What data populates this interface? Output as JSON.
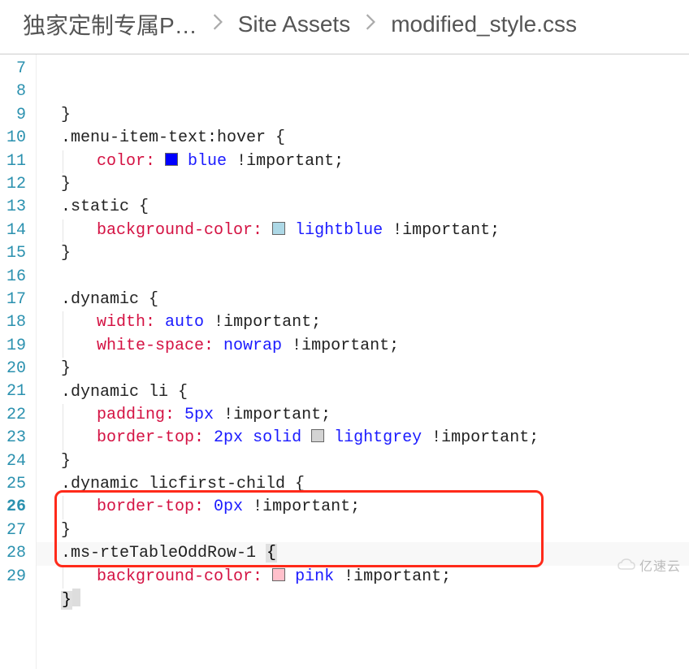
{
  "breadcrumb": {
    "items": [
      "独家定制专属P…",
      "Site Assets",
      "modified_style.css"
    ]
  },
  "colors": {
    "blue": "#0000ff",
    "lightblue": "#add8e6",
    "lightgrey": "#d3d3d3",
    "pink": "#ffc0cb"
  },
  "code": {
    "lines": [
      {
        "n": 7,
        "indent": 1,
        "tokens": [
          {
            "t": "text",
            "v": "}"
          }
        ]
      },
      {
        "n": 8,
        "indent": 1,
        "tokens": [
          {
            "t": "text",
            "v": ".menu-item-text:hover {"
          }
        ]
      },
      {
        "n": 9,
        "indent": 2,
        "guide": true,
        "tokens": [
          {
            "t": "prop",
            "v": "color:"
          },
          {
            "t": "sp",
            "v": " "
          },
          {
            "t": "swatch",
            "c": "blue"
          },
          {
            "t": "sp",
            "v": " "
          },
          {
            "t": "val",
            "v": "blue"
          },
          {
            "t": "sp",
            "v": " "
          },
          {
            "t": "imp",
            "v": "!important"
          },
          {
            "t": "text",
            "v": ";"
          }
        ]
      },
      {
        "n": 10,
        "indent": 1,
        "tokens": [
          {
            "t": "text",
            "v": "}"
          }
        ]
      },
      {
        "n": 11,
        "indent": 1,
        "tokens": [
          {
            "t": "text",
            "v": ".static {"
          }
        ]
      },
      {
        "n": 12,
        "indent": 2,
        "guide": true,
        "tokens": [
          {
            "t": "prop",
            "v": "background-color:"
          },
          {
            "t": "sp",
            "v": " "
          },
          {
            "t": "swatch",
            "c": "lightblue"
          },
          {
            "t": "sp",
            "v": " "
          },
          {
            "t": "val",
            "v": "lightblue"
          },
          {
            "t": "sp",
            "v": " "
          },
          {
            "t": "imp",
            "v": "!important"
          },
          {
            "t": "text",
            "v": ";"
          }
        ]
      },
      {
        "n": 13,
        "indent": 1,
        "tokens": [
          {
            "t": "text",
            "v": "}"
          }
        ]
      },
      {
        "n": 14,
        "indent": 1,
        "tokens": []
      },
      {
        "n": 15,
        "indent": 1,
        "tokens": [
          {
            "t": "text",
            "v": ".dynamic {"
          }
        ]
      },
      {
        "n": 16,
        "indent": 2,
        "guide": true,
        "tokens": [
          {
            "t": "prop",
            "v": "width:"
          },
          {
            "t": "sp",
            "v": " "
          },
          {
            "t": "val",
            "v": "auto"
          },
          {
            "t": "sp",
            "v": " "
          },
          {
            "t": "imp",
            "v": "!important"
          },
          {
            "t": "text",
            "v": ";"
          }
        ]
      },
      {
        "n": 17,
        "indent": 2,
        "guide": true,
        "tokens": [
          {
            "t": "prop",
            "v": "white-space:"
          },
          {
            "t": "sp",
            "v": " "
          },
          {
            "t": "val",
            "v": "nowrap"
          },
          {
            "t": "sp",
            "v": " "
          },
          {
            "t": "imp",
            "v": "!important"
          },
          {
            "t": "text",
            "v": ";"
          }
        ]
      },
      {
        "n": 18,
        "indent": 1,
        "tokens": [
          {
            "t": "text",
            "v": "}"
          }
        ]
      },
      {
        "n": 19,
        "indent": 1,
        "tokens": [
          {
            "t": "text",
            "v": ".dynamic li {"
          }
        ]
      },
      {
        "n": 20,
        "indent": 2,
        "guide": true,
        "tokens": [
          {
            "t": "prop",
            "v": "padding:"
          },
          {
            "t": "sp",
            "v": " "
          },
          {
            "t": "val",
            "v": "5px"
          },
          {
            "t": "sp",
            "v": " "
          },
          {
            "t": "imp",
            "v": "!important"
          },
          {
            "t": "text",
            "v": ";"
          }
        ]
      },
      {
        "n": 21,
        "indent": 2,
        "guide": true,
        "tokens": [
          {
            "t": "prop",
            "v": "border-top:"
          },
          {
            "t": "sp",
            "v": " "
          },
          {
            "t": "val",
            "v": "2px"
          },
          {
            "t": "sp",
            "v": " "
          },
          {
            "t": "val",
            "v": "solid"
          },
          {
            "t": "sp",
            "v": " "
          },
          {
            "t": "swatch",
            "c": "lightgrey"
          },
          {
            "t": "sp",
            "v": " "
          },
          {
            "t": "val",
            "v": "lightgrey"
          },
          {
            "t": "sp",
            "v": " "
          },
          {
            "t": "imp",
            "v": "!important"
          },
          {
            "t": "text",
            "v": ";"
          }
        ]
      },
      {
        "n": 22,
        "indent": 1,
        "tokens": [
          {
            "t": "text",
            "v": "}"
          }
        ]
      },
      {
        "n": 23,
        "indent": 1,
        "tokens": [
          {
            "t": "text",
            "v": ".dynamic licfirst-child {"
          }
        ]
      },
      {
        "n": 24,
        "indent": 2,
        "guide": true,
        "tokens": [
          {
            "t": "prop",
            "v": "border-top:"
          },
          {
            "t": "sp",
            "v": " "
          },
          {
            "t": "val",
            "v": "0px"
          },
          {
            "t": "sp",
            "v": " "
          },
          {
            "t": "imp",
            "v": "!important"
          },
          {
            "t": "text",
            "v": ";"
          }
        ]
      },
      {
        "n": 25,
        "indent": 1,
        "tokens": [
          {
            "t": "text",
            "v": "}"
          }
        ]
      },
      {
        "n": 26,
        "indent": 1,
        "current": true,
        "tokens": [
          {
            "t": "text",
            "v": ".ms-rteTableOddRow-1 "
          },
          {
            "t": "bm",
            "v": "{"
          }
        ]
      },
      {
        "n": 27,
        "indent": 2,
        "guide": true,
        "tokens": [
          {
            "t": "prop",
            "v": "background-color:"
          },
          {
            "t": "sp",
            "v": " "
          },
          {
            "t": "swatch",
            "c": "pink"
          },
          {
            "t": "sp",
            "v": " "
          },
          {
            "t": "val",
            "v": "pink"
          },
          {
            "t": "sp",
            "v": " "
          },
          {
            "t": "imp",
            "v": "!important"
          },
          {
            "t": "text",
            "v": ";"
          }
        ]
      },
      {
        "n": 28,
        "indent": 1,
        "tokens": [
          {
            "t": "bm",
            "v": "}"
          },
          {
            "t": "cursor"
          }
        ]
      },
      {
        "n": 29,
        "indent": 1,
        "cut": true,
        "tokens": []
      }
    ]
  },
  "watermark": {
    "text": "亿速云"
  }
}
